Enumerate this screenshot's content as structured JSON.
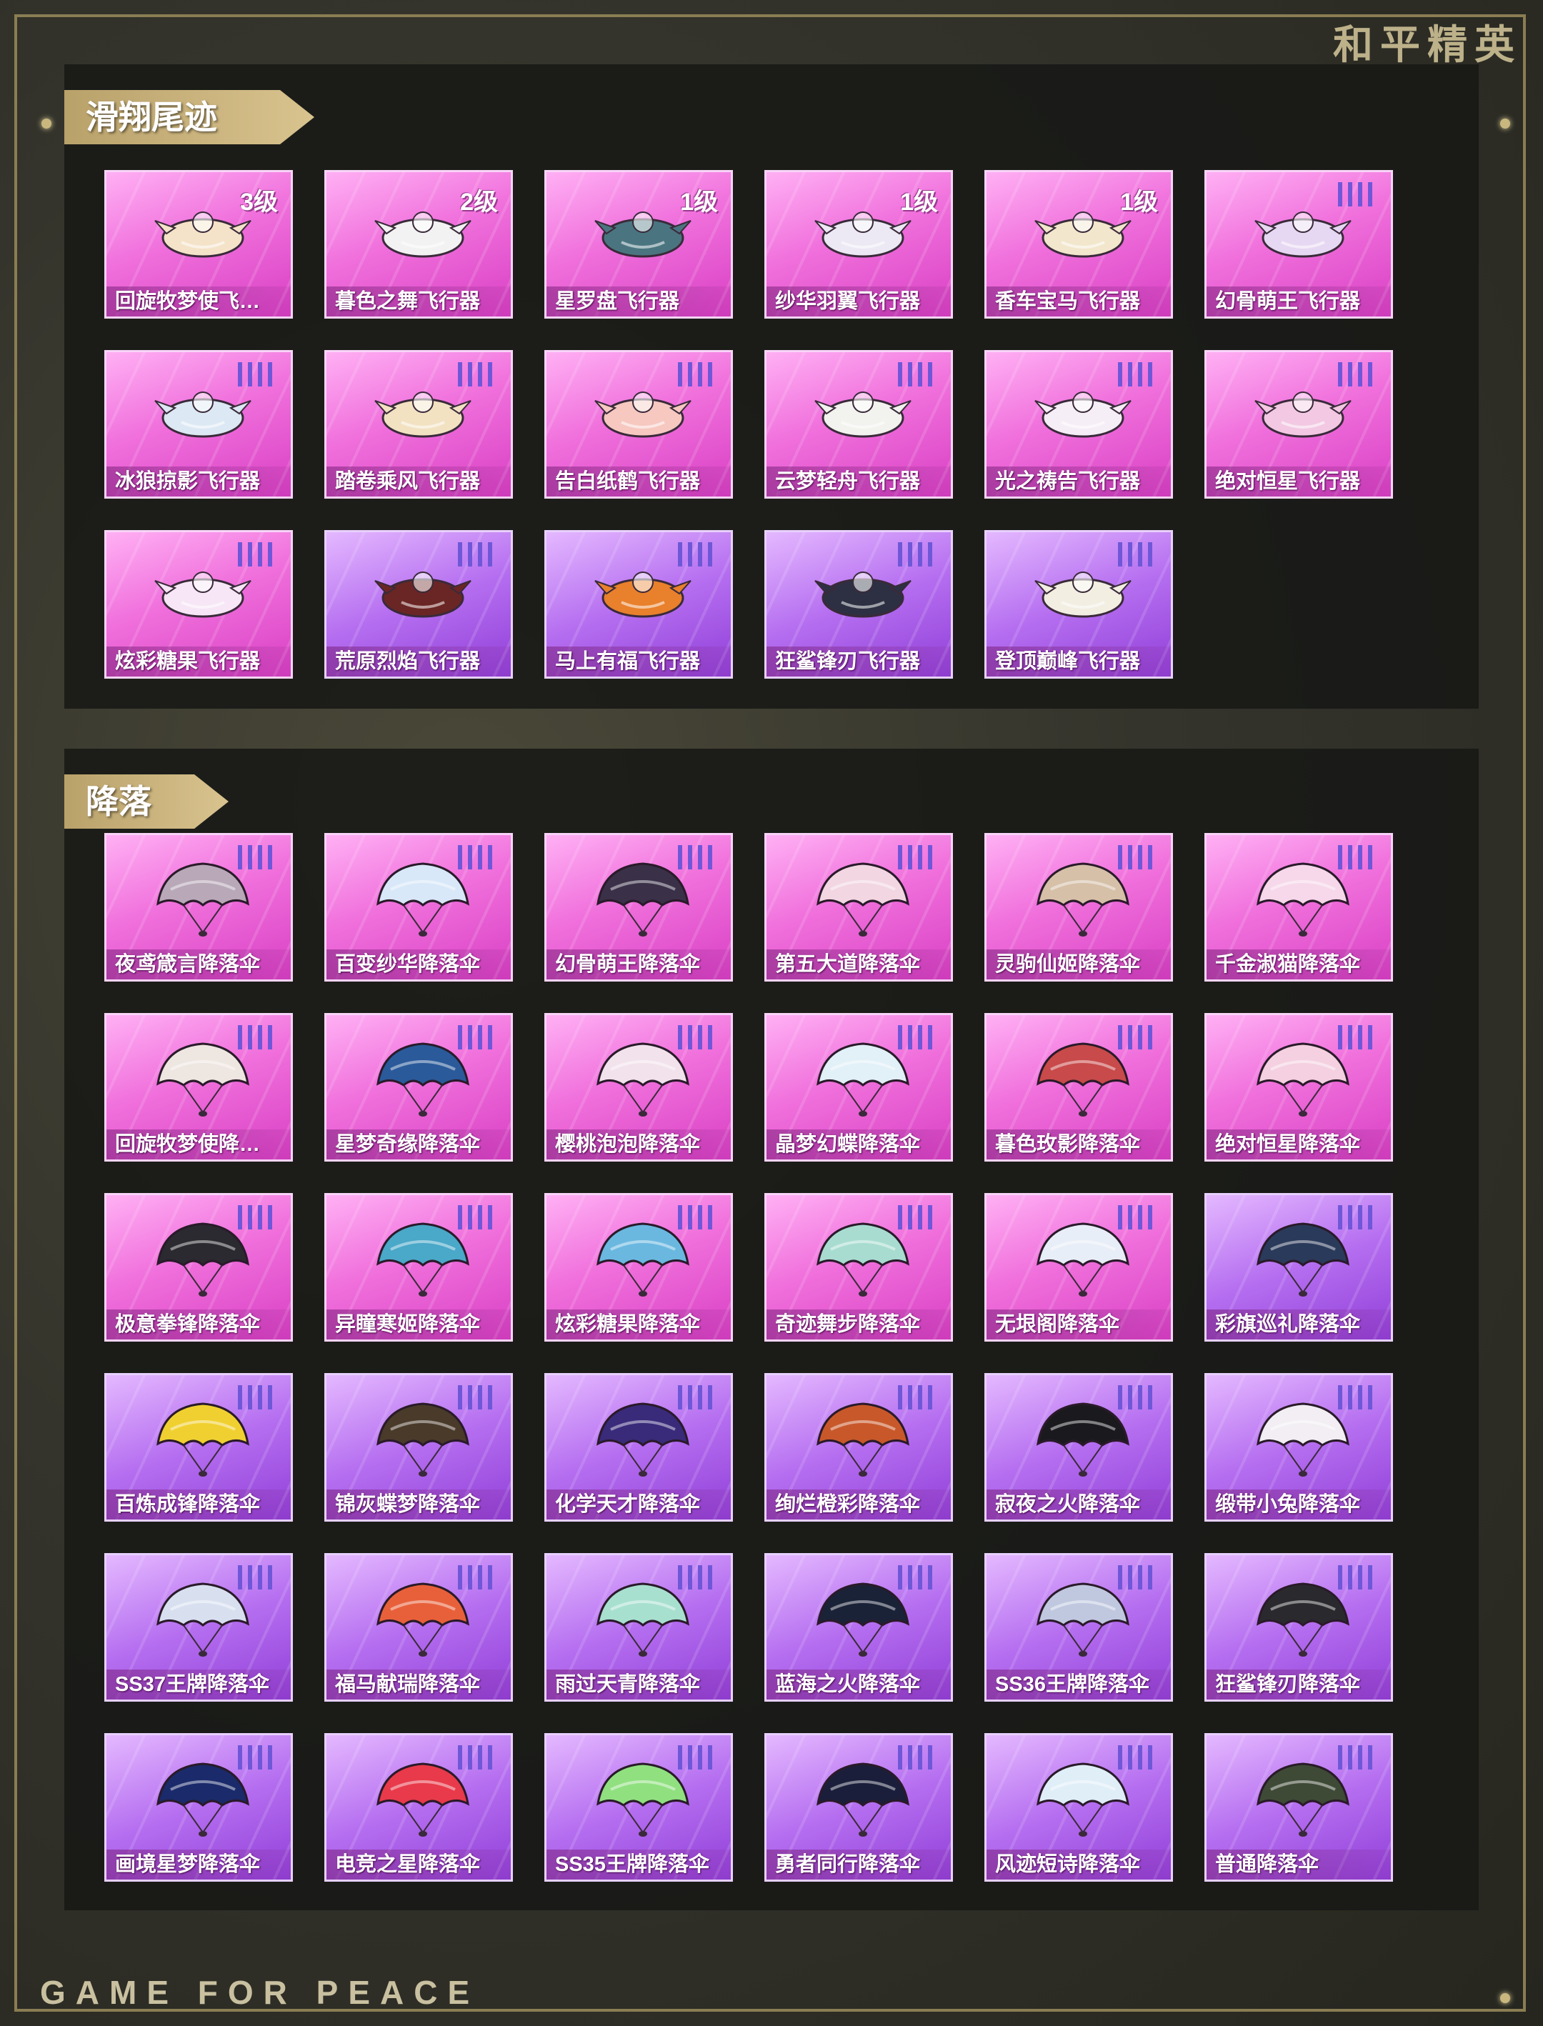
{
  "brand": {
    "title_cn": "和平精英",
    "title_en": "GAME FOR PEACE"
  },
  "trails": {
    "title": "滑翔尾迹",
    "items": [
      {
        "name": "回旋牧梦使飞…",
        "level": "3级",
        "tier": "pink",
        "icon": "carousel-glider-icon",
        "color": "#f4e3c8"
      },
      {
        "name": "暮色之舞飞行器",
        "level": "2级",
        "tier": "pink",
        "icon": "dancer-glider-icon",
        "color": "#f2f2f2"
      },
      {
        "name": "星罗盘飞行器",
        "level": "1级",
        "tier": "pink",
        "icon": "compass-glider-icon",
        "color": "#4a7580"
      },
      {
        "name": "纱华羽翼飞行器",
        "level": "1级",
        "tier": "pink",
        "icon": "wing-glider-icon",
        "color": "#ece8f4"
      },
      {
        "name": "香车宝马飞行器",
        "level": "1级",
        "tier": "pink",
        "icon": "carriage-glider-icon",
        "color": "#f2e6cc"
      },
      {
        "name": "幻骨萌王飞行器",
        "level": "",
        "tier": "pink",
        "icon": "biplane-glider-icon",
        "color": "#e6d8f2"
      },
      {
        "name": "冰狼掠影飞行器",
        "level": "",
        "tier": "pink",
        "icon": "ice-wolf-glider-icon",
        "color": "#dce8f4"
      },
      {
        "name": "踏卷乘风飞行器",
        "level": "",
        "tier": "pink",
        "icon": "scroll-glider-icon",
        "color": "#f2e2c2"
      },
      {
        "name": "告白纸鹤飞行器",
        "level": "",
        "tier": "pink",
        "icon": "paper-crane-glider-icon",
        "color": "#f6c8c0"
      },
      {
        "name": "云梦轻舟飞行器",
        "level": "",
        "tier": "pink",
        "icon": "boat-glider-icon",
        "color": "#f2f2ee"
      },
      {
        "name": "光之祷告飞行器",
        "level": "",
        "tier": "pink",
        "icon": "angel-wing-glider-icon",
        "color": "#f6eef6"
      },
      {
        "name": "绝对恒星飞行器",
        "level": "",
        "tier": "pink",
        "icon": "planet-glider-icon",
        "color": "#f2c8e2"
      },
      {
        "name": "炫彩糖果飞行器",
        "level": "",
        "tier": "pink",
        "icon": "candy-glider-icon",
        "color": "#f6e6f6"
      },
      {
        "name": "荒原烈焰飞行器",
        "level": "",
        "tier": "purple",
        "icon": "flame-glider-icon",
        "color": "#6a2624"
      },
      {
        "name": "马上有福飞行器",
        "level": "",
        "tier": "purple",
        "icon": "horse-glider-icon",
        "color": "#e8802c"
      },
      {
        "name": "狂鲨锋刃飞行器",
        "level": "",
        "tier": "purple",
        "icon": "shark-glider-icon",
        "color": "#2c3042"
      },
      {
        "name": "登顶巅峰飞行器",
        "level": "",
        "tier": "purple",
        "icon": "jet-glider-icon",
        "color": "#f2eee2"
      }
    ]
  },
  "parachutes": {
    "title": "降落伞",
    "items": [
      {
        "name": "夜鸢箴言降落伞",
        "tier": "pink",
        "icon": "parachute-icon",
        "color": "#b8a8b8"
      },
      {
        "name": "百变纱华降落伞",
        "tier": "pink",
        "icon": "parachute-icon",
        "color": "#d8e8f8"
      },
      {
        "name": "幻骨萌王降落伞",
        "tier": "pink",
        "icon": "parachute-icon",
        "color": "#3a3048"
      },
      {
        "name": "第五大道降落伞",
        "tier": "pink",
        "icon": "parachute-icon",
        "color": "#f2d6e2"
      },
      {
        "name": "灵驹仙姬降落伞",
        "tier": "pink",
        "icon": "parachute-icon",
        "color": "#d6c0a8"
      },
      {
        "name": "千金淑猫降落伞",
        "tier": "pink",
        "icon": "parachute-icon",
        "color": "#f6d8ea"
      },
      {
        "name": "回旋牧梦使降…",
        "tier": "pink",
        "icon": "parachute-icon",
        "color": "#eee6e0"
      },
      {
        "name": "星梦奇缘降落伞",
        "tier": "pink",
        "icon": "parachute-icon",
        "color": "#2a5a9a"
      },
      {
        "name": "樱桃泡泡降落伞",
        "tier": "pink",
        "icon": "parachute-icon",
        "color": "#f2e2ec"
      },
      {
        "name": "晶梦幻蝶降落伞",
        "tier": "pink",
        "icon": "parachute-icon",
        "color": "#e2f0f8"
      },
      {
        "name": "暮色玫影降落伞",
        "tier": "pink",
        "icon": "parachute-icon",
        "color": "#c84a4a"
      },
      {
        "name": "绝对恒星降落伞",
        "tier": "pink",
        "icon": "parachute-icon",
        "color": "#f4d0e0"
      },
      {
        "name": "极意拳锋降落伞",
        "tier": "pink",
        "icon": "parachute-icon",
        "color": "#2a2a30"
      },
      {
        "name": "异瞳寒姬降落伞",
        "tier": "pink",
        "icon": "parachute-icon",
        "color": "#4aa8c8"
      },
      {
        "name": "炫彩糖果降落伞",
        "tier": "pink",
        "icon": "parachute-icon",
        "color": "#6ab8e0"
      },
      {
        "name": "奇迹舞步降落伞",
        "tier": "pink",
        "icon": "parachute-icon",
        "color": "#a8dcd0"
      },
      {
        "name": "无垠阁降落伞",
        "tier": "pink",
        "icon": "parachute-icon",
        "color": "#e8eef8"
      },
      {
        "name": "彩旗巡礼降落伞",
        "tier": "purple",
        "icon": "parachute-icon",
        "color": "#2a3a5a"
      },
      {
        "name": "百炼成锋降落伞",
        "tier": "purple",
        "icon": "parachute-icon",
        "color": "#f0d030"
      },
      {
        "name": "锦灰蝶梦降落伞",
        "tier": "purple",
        "icon": "parachute-icon",
        "color": "#4a3a2a"
      },
      {
        "name": "化学天才降落伞",
        "tier": "purple",
        "icon": "parachute-icon",
        "color": "#3a2a7a"
      },
      {
        "name": "绚烂橙彩降落伞",
        "tier": "purple",
        "icon": "parachute-icon",
        "color": "#c8582a"
      },
      {
        "name": "寂夜之火降落伞",
        "tier": "purple",
        "icon": "parachute-icon",
        "color": "#1a1a1e"
      },
      {
        "name": "缎带小兔降落伞",
        "tier": "purple",
        "icon": "parachute-icon",
        "color": "#f2eef4"
      },
      {
        "name": "SS37王牌降落伞",
        "tier": "purple",
        "icon": "parachute-icon",
        "color": "#d8e0f0"
      },
      {
        "name": "福马献瑞降落伞",
        "tier": "purple",
        "icon": "parachute-icon",
        "color": "#e8603a"
      },
      {
        "name": "雨过天青降落伞",
        "tier": "purple",
        "icon": "parachute-icon",
        "color": "#a8e0d0"
      },
      {
        "name": "蓝海之火降落伞",
        "tier": "purple",
        "icon": "parachute-icon",
        "color": "#1a2238"
      },
      {
        "name": "SS36王牌降落伞",
        "tier": "purple",
        "icon": "parachute-icon",
        "color": "#c0c8e0"
      },
      {
        "name": "狂鲨锋刃降落伞",
        "tier": "purple",
        "icon": "parachute-icon",
        "color": "#2a2a2e"
      },
      {
        "name": "画境星梦降落伞",
        "tier": "purple",
        "icon": "parachute-icon",
        "color": "#1a2a6a"
      },
      {
        "name": "电竞之星降落伞",
        "tier": "purple",
        "icon": "parachute-icon",
        "color": "#e83a4a"
      },
      {
        "name": "SS35王牌降落伞",
        "tier": "purple",
        "icon": "parachute-icon",
        "color": "#90e080"
      },
      {
        "name": "勇者同行降落伞",
        "tier": "purple",
        "icon": "parachute-icon",
        "color": "#1a1e3a"
      },
      {
        "name": "风迹短诗降落伞",
        "tier": "purple",
        "icon": "parachute-icon",
        "color": "#e0eef8"
      },
      {
        "name": "普通降落伞",
        "tier": "purple",
        "icon": "parachute-icon",
        "color": "#3e4a36"
      }
    ]
  }
}
